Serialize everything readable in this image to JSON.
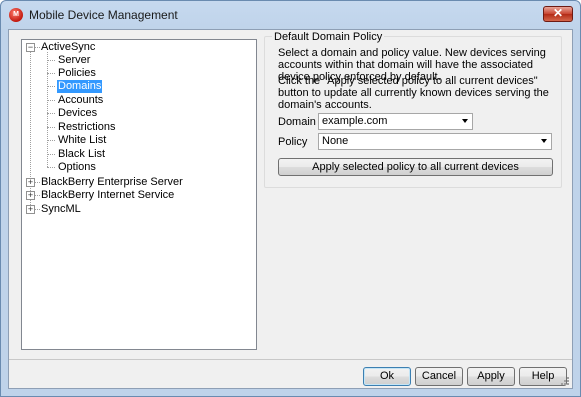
{
  "window": {
    "title": "Mobile Device Management",
    "icon_text": "M",
    "close_glyph": "✕"
  },
  "tree": {
    "activesync": {
      "label": "ActiveSync",
      "expander": "−"
    },
    "children": [
      "Server",
      "Policies",
      "Domains",
      "Accounts",
      "Devices",
      "Restrictions",
      "White List",
      "Black List",
      "Options"
    ],
    "selected": "Domains",
    "others": [
      {
        "label": "BlackBerry Enterprise Server",
        "expander": "+"
      },
      {
        "label": "BlackBerry Internet Service",
        "expander": "+"
      },
      {
        "label": "SyncML",
        "expander": "+"
      }
    ]
  },
  "panel": {
    "group_title": "Default Domain Policy",
    "desc1": "Select a domain and policy value.  New devices serving accounts within that domain will have the associated device policy enforced by default.",
    "desc2": "Click the \"Apply selected policy to all current devices\" button to update all currently known devices serving the domain's accounts.",
    "domain_label": "Domain",
    "domain_value": "example.com",
    "policy_label": "Policy",
    "policy_value": "None",
    "apply_button": "Apply selected policy to all current devices"
  },
  "footer": {
    "ok": "Ok",
    "cancel": "Cancel",
    "apply": "Apply",
    "help": "Help"
  }
}
